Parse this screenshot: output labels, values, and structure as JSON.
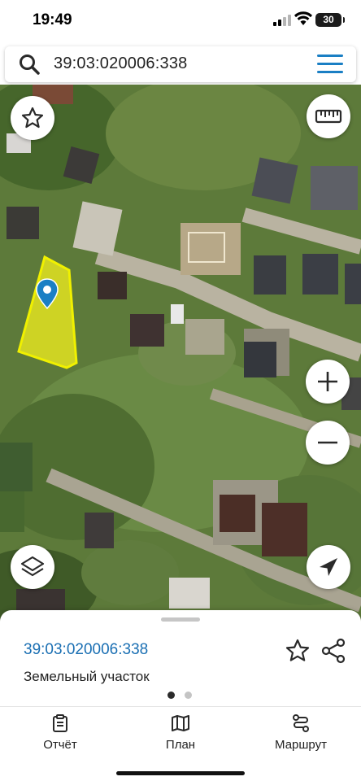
{
  "status_bar": {
    "time": "19:49",
    "battery": "30"
  },
  "search": {
    "query": "39:03:020006:338",
    "icon": "search-icon",
    "menu_icon": "menu-icon"
  },
  "map": {
    "controls": {
      "favorite": "star-icon",
      "ruler": "ruler-icon",
      "zoom_in": "plus-icon",
      "zoom_out": "minus-icon",
      "layers": "layers-icon",
      "location": "navigation-arrow-icon"
    },
    "colors": {
      "parcel_fill": "#e6e620",
      "parcel_stroke": "#f0f000",
      "marker": "#1a7fc4"
    }
  },
  "info_sheet": {
    "cadastral_number": "39:03:020006:338",
    "object_type": "Земельный участок",
    "page_count": 2,
    "active_page": 1
  },
  "bottom_nav": {
    "items": [
      {
        "label": "Отчёт",
        "icon": "report-icon"
      },
      {
        "label": "План",
        "icon": "map-plan-icon"
      },
      {
        "label": "Маршрут",
        "icon": "route-icon"
      }
    ]
  },
  "colors": {
    "accent": "#1a7fc4",
    "link": "#1a6fb3",
    "text": "#222222"
  }
}
